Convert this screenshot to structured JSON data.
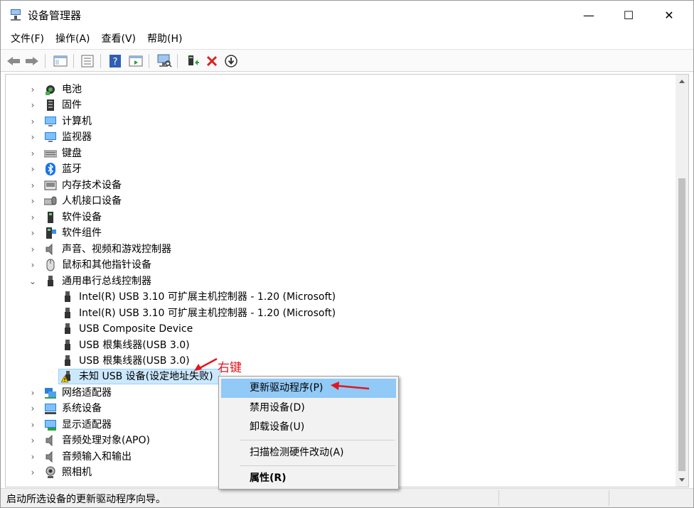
{
  "window": {
    "title": "设备管理器",
    "minimize_glyph": "—",
    "maximize_glyph": "☐",
    "close_glyph": "✕"
  },
  "menu": [
    "文件(F)",
    "操作(A)",
    "查看(V)",
    "帮助(H)"
  ],
  "toolbar": {
    "icons": [
      "back-icon",
      "forward-icon",
      "show-hide-console-tree-icon",
      "properties-icon",
      "help-icon",
      "action-pane-icon",
      "scan-hardware-icon",
      "update-driver-icon",
      "uninstall-icon",
      "disable-icon"
    ]
  },
  "tree": {
    "items": [
      {
        "label": "电池",
        "icon": "battery-icon",
        "expander": "›"
      },
      {
        "label": "固件",
        "icon": "firmware-icon",
        "expander": "›"
      },
      {
        "label": "计算机",
        "icon": "computer-icon",
        "expander": "›"
      },
      {
        "label": "监视器",
        "icon": "monitor-icon",
        "expander": "›"
      },
      {
        "label": "键盘",
        "icon": "keyboard-icon",
        "expander": "›"
      },
      {
        "label": "蓝牙",
        "icon": "bluetooth-icon",
        "expander": "›"
      },
      {
        "label": "内存技术设备",
        "icon": "memory-device-icon",
        "expander": "›"
      },
      {
        "label": "人机接口设备",
        "icon": "hid-icon",
        "expander": "›"
      },
      {
        "label": "软件设备",
        "icon": "software-device-icon",
        "expander": "›"
      },
      {
        "label": "软件组件",
        "icon": "software-component-icon",
        "expander": "›"
      },
      {
        "label": "声音、视频和游戏控制器",
        "icon": "speaker-icon",
        "expander": "›"
      },
      {
        "label": "鼠标和其他指针设备",
        "icon": "mouse-icon",
        "expander": "›"
      },
      {
        "label": "通用串行总线控制器",
        "icon": "usb-icon",
        "expander": "⌄"
      }
    ],
    "usb_children": [
      {
        "label": "Intel(R) USB 3.10 可扩展主机控制器 - 1.20 (Microsoft)",
        "icon": "usb-icon"
      },
      {
        "label": "Intel(R) USB 3.10 可扩展主机控制器 - 1.20 (Microsoft)",
        "icon": "usb-icon"
      },
      {
        "label": "USB Composite Device",
        "icon": "usb-icon"
      },
      {
        "label": "USB 根集线器(USB 3.0)",
        "icon": "usb-icon"
      },
      {
        "label": "USB 根集线器(USB 3.0)",
        "icon": "usb-icon"
      },
      {
        "label": "未知 USB 设备(设定地址失败)",
        "icon": "warning-usb-icon"
      }
    ],
    "items_after": [
      {
        "label": "网络适配器",
        "icon": "network-adapter-icon",
        "expander": "›"
      },
      {
        "label": "系统设备",
        "icon": "system-device-icon",
        "expander": "›"
      },
      {
        "label": "显示适配器",
        "icon": "display-adapter-icon",
        "expander": "›"
      },
      {
        "label": "音频处理对象(APO)",
        "icon": "speaker-icon",
        "expander": "›"
      },
      {
        "label": "音频输入和输出",
        "icon": "speaker-icon",
        "expander": "›"
      },
      {
        "label": "照相机",
        "icon": "camera-icon",
        "expander": "›"
      }
    ]
  },
  "context_menu": {
    "update_driver": "更新驱动程序(P)",
    "disable": "禁用设备(D)",
    "uninstall": "卸载设备(U)",
    "scan": "扫描检测硬件改动(A)",
    "properties": "属性(R)"
  },
  "annotation": {
    "text": "右键",
    "color": "#e0171f"
  },
  "status": {
    "text": "启动所选设备的更新驱动程序向导。"
  },
  "colors": {
    "selection": "#cce8ff",
    "menu_highlight": "#91c9f7",
    "annotation": "#e0171f"
  }
}
